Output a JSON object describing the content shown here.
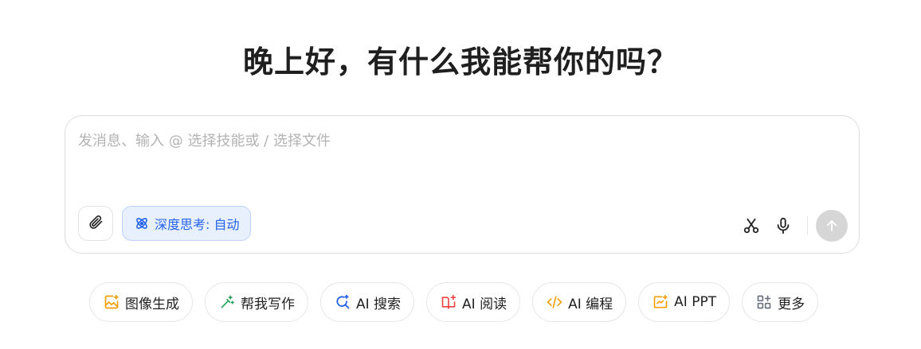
{
  "header": {
    "greeting": "晚上好，有什么我能帮你的吗？"
  },
  "composer": {
    "placeholder": "发消息、输入 @ 选择技能或 / 选择文件",
    "value": "",
    "attach_icon": "paperclip-icon",
    "deep_think": {
      "icon": "atom-icon",
      "label": "深度思考: 自动"
    },
    "tools": {
      "cut_icon": "scissors-icon",
      "mic_icon": "microphone-icon",
      "send_icon": "arrow-up-icon"
    }
  },
  "quick_actions": [
    {
      "label": "图像生成",
      "icon": "image-sparkle-icon",
      "color": "#f59e0b"
    },
    {
      "label": "帮我写作",
      "icon": "pen-sparkle-icon",
      "color": "#22a35a"
    },
    {
      "label": "AI 搜索",
      "icon": "search-sparkle-icon",
      "color": "#2563eb"
    },
    {
      "label": "AI 阅读",
      "icon": "book-sparkle-icon",
      "color": "#ef4444"
    },
    {
      "label": "AI 编程",
      "icon": "code-icon",
      "color": "#f59e0b"
    },
    {
      "label": "AI PPT",
      "icon": "slides-icon",
      "color": "#f59e0b"
    },
    {
      "label": "更多",
      "icon": "grid-icon",
      "color": "#6b7280"
    }
  ],
  "colors": {
    "accent": "#2563eb",
    "accent_bg": "#e8f0fe",
    "send_disabled": "#d6d6d6"
  }
}
